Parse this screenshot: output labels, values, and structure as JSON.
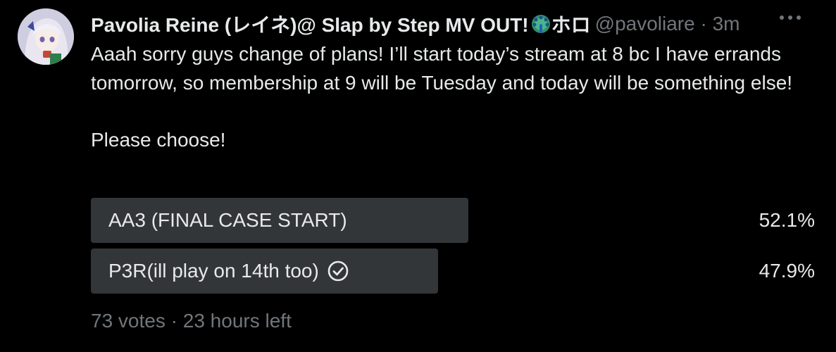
{
  "tweet": {
    "author_name": "Pavolia Reine (レイネ)@ Slap by Step MV OUT!",
    "author_emoji": "peacock-emoji",
    "author_name_tail": "ホロ",
    "handle": "@pavoliare",
    "separator": "·",
    "timestamp": "3m",
    "text_paragraph_1": "Aaah sorry guys change of plans! I’ll start today’s stream at 8 bc I have errands tomorrow, so membership at 9 will be Tuesday and today will be something else!",
    "text_paragraph_2": "Please choose!"
  },
  "poll": {
    "options": [
      {
        "label": "AA3 (FINAL CASE START)",
        "percent": "52.1%",
        "fraction": 0.521,
        "selected": false
      },
      {
        "label": "P3R(ill play on 14th too)",
        "percent": "47.9%",
        "fraction": 0.479,
        "selected": true
      }
    ],
    "votes": "73 votes",
    "separator": "·",
    "time_left": "23 hours left"
  },
  "icons": {
    "more": "more-horizontal-icon",
    "check": "check-circle-icon"
  },
  "colors": {
    "background": "#000000",
    "text_primary": "#e7e9ea",
    "text_secondary": "#71767b",
    "poll_bar": "#333639"
  }
}
